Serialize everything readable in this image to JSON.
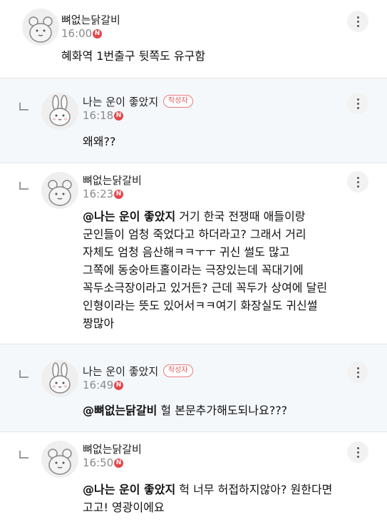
{
  "comments": [
    {
      "author": "뼈없는닭갈비",
      "time": "16:00",
      "new_badge": "N",
      "text_lines": [
        "혜화역 1번출구 뒷쪽도 유구함"
      ],
      "avatar_icon": "bear-avatar-icon"
    },
    {
      "author": "나는 운이 좋았지",
      "author_badge": "작성자",
      "time": "16:18",
      "new_badge": "N",
      "text_lines": [
        "왜왜??"
      ],
      "avatar_icon": "rabbit-avatar-icon"
    },
    {
      "author": "뼈없는닭갈비",
      "time": "16:23",
      "new_badge": "N",
      "mention": "@나는 운이 좋았지",
      "first_line_rest": " 거기 한국 전쟁때 애들이랑",
      "text_lines": [
        "군인들이 엄청 죽었다고 하더라고? 그래서 거리",
        "자체도 엄청 음산해ㅋㅋㅜㅜ 귀신 썰도 많고",
        "그쪽에 동숭아트홀이라는 극장있는데 꼭대기에",
        "꼭두소극장이라고 있거든? 근데 꼭두가 상여에 달린",
        "인형이라는 뜻도 있어서ㅋㅋ여기 화장실도 귀신썰",
        "짱많아"
      ],
      "avatar_icon": "bear-avatar-icon"
    },
    {
      "author": "나는 운이 좋았지",
      "author_badge": "작성자",
      "time": "16:49",
      "new_badge": "N",
      "mention": "@뼈없는닭갈비",
      "first_line_rest": " 헐 본문추가해도되나요???",
      "avatar_icon": "rabbit-avatar-icon"
    },
    {
      "author": "뼈없는닭갈비",
      "time": "16:50",
      "new_badge": "N",
      "mention": "@나는 운이 좋았지",
      "first_line_rest": " 헉 너무 허접하지않아? 원한다면",
      "text_lines": [
        "고고! 영광이에요"
      ],
      "avatar_icon": "bear-avatar-icon"
    }
  ],
  "icons": {
    "more": "more-vertical-icon",
    "reply": "reply-indent-icon"
  },
  "colors": {
    "new_badge": "#e4474b",
    "author_badge": "#e05a5a",
    "reply_background": "#f5f8fb"
  }
}
